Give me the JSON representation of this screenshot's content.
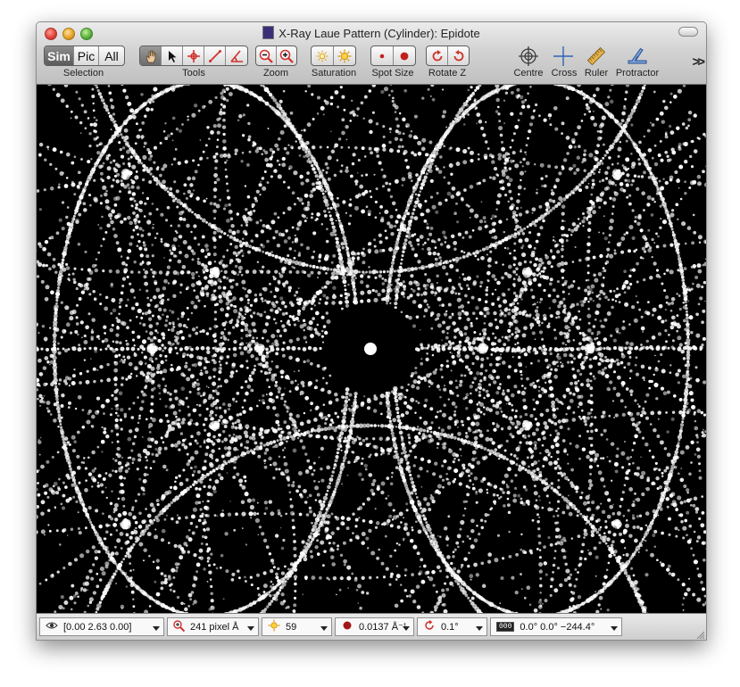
{
  "window": {
    "title": "X-Ray Laue Pattern (Cylinder): Epidote"
  },
  "toolbar": {
    "selection": {
      "label": "Selection",
      "options": [
        "Sim",
        "Pic",
        "All"
      ],
      "active": "Sim"
    },
    "tools": {
      "label": "Tools",
      "items": [
        "hand-icon",
        "arrow-pointer-icon",
        "move-crosshair-icon",
        "line-measure-icon",
        "angle-measure-icon"
      ],
      "active": "hand-icon"
    },
    "zoom": {
      "label": "Zoom",
      "items": [
        "zoom-out-icon",
        "zoom-in-icon"
      ]
    },
    "saturation": {
      "label": "Saturation",
      "items": [
        "saturation-low-icon",
        "saturation-high-icon"
      ]
    },
    "spot_size": {
      "label": "Spot Size",
      "items": [
        "spot-small-icon",
        "spot-large-icon"
      ]
    },
    "rotate_z": {
      "label": "Rotate Z",
      "items": [
        "rotate-clockwise-icon",
        "rotate-anticlockwise-icon"
      ]
    },
    "centre": {
      "label": "Centre",
      "icon": "centre-target-icon"
    },
    "cross": {
      "label": "Cross",
      "icon": "cross-icon"
    },
    "ruler": {
      "label": "Ruler",
      "icon": "ruler-icon"
    },
    "protractor": {
      "label": "Protractor",
      "icon": "protractor-icon"
    },
    "overflow": {
      "label": ">>"
    }
  },
  "statusbar": {
    "view_direction": {
      "icon": "eye-icon",
      "value": "[0.00  2.63  0.00]"
    },
    "scale": {
      "icon": "magnifier-icon",
      "value": "241 pixel Å"
    },
    "saturation": {
      "icon": "sun-icon",
      "value": "59"
    },
    "spot_size": {
      "icon": "spot-icon",
      "value": "0.0137 Å⁻¹"
    },
    "rotation_step": {
      "icon": "rotate-icon",
      "value": "0.1°"
    },
    "orientation": {
      "icon": "orientation-badge-icon",
      "badge": "000",
      "value": "0.0°  0.0°  −244.4°"
    }
  },
  "colors": {
    "canvas_bg": "#000000",
    "spot": "#ffffff",
    "tool_red": "#d0312d"
  }
}
